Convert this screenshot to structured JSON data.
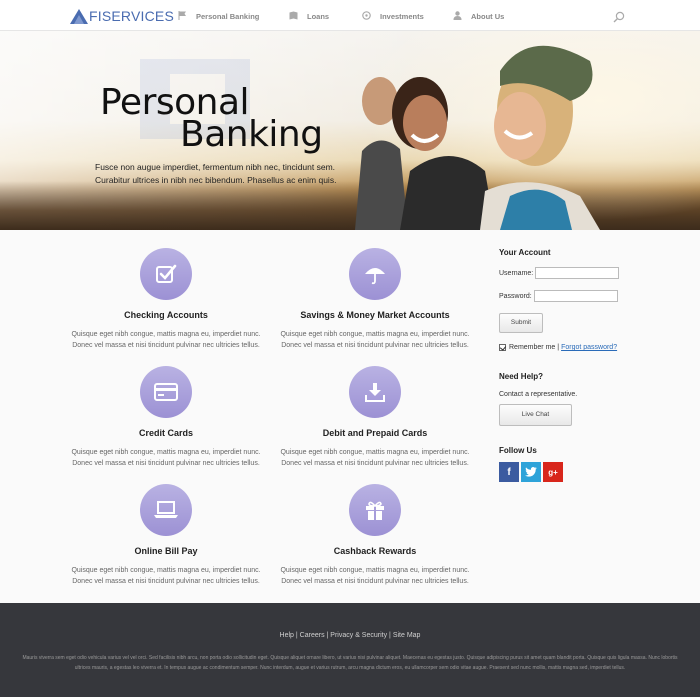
{
  "nav": {
    "logo_text": "FISERVICES",
    "items": [
      {
        "label": "Personal Banking",
        "icon": "flag-icon"
      },
      {
        "label": "Loans",
        "icon": "book-icon"
      },
      {
        "label": "Investments",
        "icon": "globe-icon"
      },
      {
        "label": "About Us",
        "icon": "person-icon"
      }
    ]
  },
  "hero": {
    "title_line1": "Personal",
    "title_line2": "Banking",
    "subtitle": "Fusce non augue imperdiet, fermentum nibh nec, tincidunt sem. Curabitur ultrices in nibh nec bibendum. Phasellus ac enim quis."
  },
  "services": [
    {
      "title": "Checking Accounts",
      "icon": "checkbox-icon",
      "desc": "Quisque eget nibh congue, mattis magna eu, imperdiet nunc. Donec vel massa et nisi tincidunt pulvinar nec ultricies tellus."
    },
    {
      "title": "Savings & Money Market Accounts",
      "icon": "umbrella-icon",
      "desc": "Quisque eget nibh congue, mattis magna eu, imperdiet nunc. Donec vel massa et nisi tincidunt pulvinar nec ultricies tellus."
    },
    {
      "title": "Credit Cards",
      "icon": "credit-card-icon",
      "desc": "Quisque eget nibh congue, mattis magna eu, imperdiet nunc. Donec vel massa et nisi tincidunt pulvinar nec ultricies tellus."
    },
    {
      "title": "Debit and Prepaid Cards",
      "icon": "download-tray-icon",
      "desc": "Quisque eget nibh congue, mattis magna eu, imperdiet nunc. Donec vel massa et nisi tincidunt pulvinar nec ultricies tellus."
    },
    {
      "title": "Online Bill Pay",
      "icon": "laptop-icon",
      "desc": "Quisque eget nibh congue, mattis magna eu, imperdiet nunc. Donec vel massa et nisi tincidunt pulvinar nec ultricies tellus."
    },
    {
      "title": "Cashback Rewards",
      "icon": "gift-icon",
      "desc": "Quisque eget nibh congue, mattis magna eu, imperdiet nunc. Donec vel massa et nisi tincidunt pulvinar nec ultricies tellus."
    }
  ],
  "account": {
    "heading": "Your Account",
    "username_label": "Username:",
    "password_label": "Password:",
    "username_value": "",
    "password_value": "",
    "submit_label": "Submit",
    "remember_label": "Remember me |",
    "remember_checked": true,
    "forgot_label": "Forgot password?"
  },
  "help": {
    "heading": "Need Help?",
    "text": "Contact a representative.",
    "chat_label": "Live Chat"
  },
  "follow": {
    "heading": "Follow Us",
    "facebook": "f",
    "twitter": "t",
    "googleplus": "g+"
  },
  "footer": {
    "links": [
      "Help",
      "Careers",
      "Privacy & Security",
      "Site Map"
    ],
    "separator": " | ",
    "text": "Mauris viverra sem eget odio vehicula varius vel vel orci. Sed facilisis nibh arcu, non porta odio sollicitudin eget. Quisque aliquet ornare libero, ut varius nisi pulvinar aliquet. Maecenas eu egestas justo. Quisque adipiscing purus sit amet quam blandit porta. Quisque quis ligula massa. Nunc lobortis ultrices mauris, a egestas leo viverra et. In tempus augue ac condimentum semper. Nunc interdum, augue et varius rutrum, arcu magna dictum eros, eu ullamcorper sem odio vitae augue. Praesent sed nunc mollis, mattis magna sed, imperdiet tellus."
  },
  "colors": {
    "brand": "#4a6cb0",
    "icon_circle": "#a79ddb",
    "footer_bg": "#36373c",
    "link": "#2a6bb8"
  }
}
